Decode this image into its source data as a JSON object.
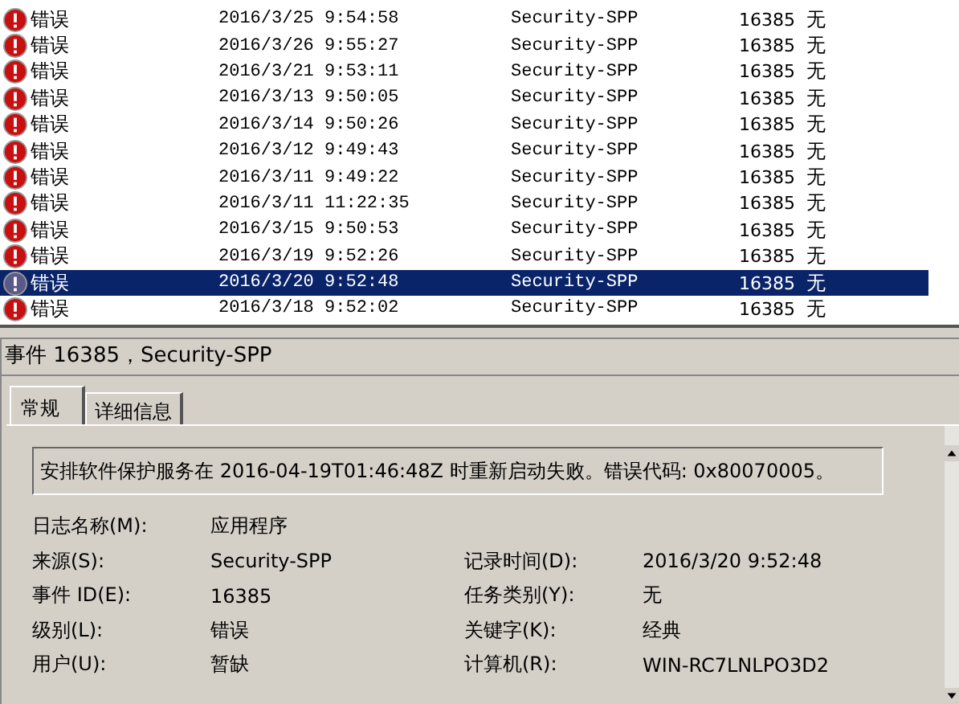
{
  "events": [
    {
      "level": "错误",
      "date": "2016/3/25 9:54:58",
      "source": "Security-SPP",
      "id": "16385",
      "task": "无",
      "selected": false
    },
    {
      "level": "错误",
      "date": "2016/3/26 9:55:27",
      "source": "Security-SPP",
      "id": "16385",
      "task": "无",
      "selected": false
    },
    {
      "level": "错误",
      "date": "2016/3/21 9:53:11",
      "source": "Security-SPP",
      "id": "16385",
      "task": "无",
      "selected": false
    },
    {
      "level": "错误",
      "date": "2016/3/13 9:50:05",
      "source": "Security-SPP",
      "id": "16385",
      "task": "无",
      "selected": false
    },
    {
      "level": "错误",
      "date": "2016/3/14 9:50:26",
      "source": "Security-SPP",
      "id": "16385",
      "task": "无",
      "selected": false
    },
    {
      "level": "错误",
      "date": "2016/3/12 9:49:43",
      "source": "Security-SPP",
      "id": "16385",
      "task": "无",
      "selected": false
    },
    {
      "level": "错误",
      "date": "2016/3/11 9:49:22",
      "source": "Security-SPP",
      "id": "16385",
      "task": "无",
      "selected": false
    },
    {
      "level": "错误",
      "date": "2016/3/11 11:22:35",
      "source": "Security-SPP",
      "id": "16385",
      "task": "无",
      "selected": false
    },
    {
      "level": "错误",
      "date": "2016/3/15 9:50:53",
      "source": "Security-SPP",
      "id": "16385",
      "task": "无",
      "selected": false
    },
    {
      "level": "错误",
      "date": "2016/3/19 9:52:26",
      "source": "Security-SPP",
      "id": "16385",
      "task": "无",
      "selected": false
    },
    {
      "level": "错误",
      "date": "2016/3/20 9:52:48",
      "source": "Security-SPP",
      "id": "16385",
      "task": "无",
      "selected": true
    },
    {
      "level": "错误",
      "date": "2016/3/18 9:52:02",
      "source": "Security-SPP",
      "id": "16385",
      "task": "无",
      "selected": false
    }
  ],
  "detail": {
    "title": "事件 16385，Security-SPP",
    "tabs": [
      {
        "label": "常规",
        "selected": true
      },
      {
        "label": "详细信息",
        "selected": false
      }
    ],
    "message": "安排软件保护服务在 2016-04-19T01:46:48Z 时重新启动失败。错误代码: 0x80070005。",
    "fields": [
      [
        {
          "label": "日志名称(M):",
          "value": "应用程序"
        }
      ],
      [
        {
          "label": "来源(S):",
          "value": "Security-SPP"
        },
        {
          "label": "记录时间(D):",
          "value": "2016/3/20 9:52:48"
        }
      ],
      [
        {
          "label": "事件 ID(E):",
          "value": "16385"
        },
        {
          "label": "任务类别(Y):",
          "value": "无"
        }
      ],
      [
        {
          "label": "级别(L):",
          "value": "错误"
        },
        {
          "label": "关键字(K):",
          "value": "经典"
        }
      ],
      [
        {
          "label": "用户(U):",
          "value": "暂缺"
        },
        {
          "label": "计算机(R):",
          "value": "WIN-RC7LNLPO3D2"
        }
      ]
    ]
  }
}
